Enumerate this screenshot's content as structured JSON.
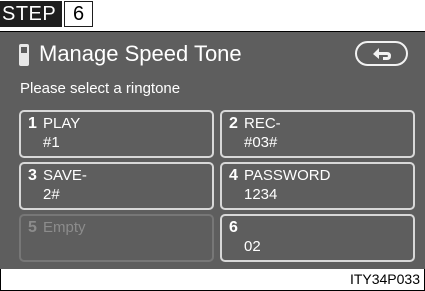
{
  "step": {
    "label": "STEP",
    "number": "6"
  },
  "screen": {
    "title": "Manage Speed Tone",
    "subtitle": "Please select a ringtone",
    "back_icon": "back-arrow-icon",
    "phone_icon": "phone-icon"
  },
  "ringtones": [
    {
      "number": "1",
      "line1": "PLAY",
      "line2": "#1"
    },
    {
      "number": "2",
      "line1": "REC-",
      "line2": "#03#"
    },
    {
      "number": "3",
      "line1": "SAVE-",
      "line2": "2#"
    },
    {
      "number": "4",
      "line1": "PASSWORD",
      "line2": "1234"
    },
    {
      "number": "5",
      "line1": "Empty",
      "line2": ""
    },
    {
      "number": "6",
      "line1": "",
      "line2": "02"
    }
  ],
  "caption": "ITY34P033",
  "colors": {
    "screen_bg": "#5e5e5e",
    "text": "#ffffff",
    "disabled": "#8c8c8c"
  }
}
